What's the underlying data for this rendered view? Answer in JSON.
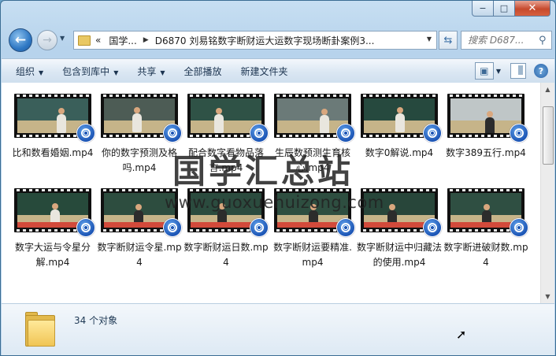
{
  "window": {
    "caption": {
      "minimize": "−",
      "maximize": "□",
      "close": "✕"
    }
  },
  "nav": {
    "address_segments": [
      "«",
      "国学...",
      "D6870 刘易铭数字断财运大运数字现场断卦案例3..."
    ],
    "search_placeholder": "搜索 D687..."
  },
  "toolbar": {
    "items": [
      "组织",
      "包含到库中",
      "共享",
      "全部播放",
      "新建文件夹"
    ]
  },
  "files": [
    {
      "name": "比和数看婚姻.mp4",
      "board": "#3a5f5a",
      "person": "light"
    },
    {
      "name": "你的数字预测及格吗.mp4",
      "board": "#4d5c55",
      "person": "light"
    },
    {
      "name": "配合数字看物品落言.mp4",
      "board": "#2f5246",
      "person": "light"
    },
    {
      "name": "生辰数预测生育核心.mp4",
      "board": "#6b7a78",
      "person": "light"
    },
    {
      "name": "数字0解说.mp4",
      "board": "#26493e",
      "person": "light"
    },
    {
      "name": "数字389五行.mp4",
      "board": "#bfc6c7",
      "person": "dark"
    },
    {
      "name": "数字大运与令星分解.mp4",
      "board": "#274a3b",
      "person": "light"
    },
    {
      "name": "数字断财运令星.mp4",
      "board": "#2d4d3f",
      "person": "dark"
    },
    {
      "name": "数字断财运日数.mp4",
      "board": "#2b4b3e",
      "person": "dark"
    },
    {
      "name": "数字断财运要精准.mp4",
      "board": "#2e4e40",
      "person": "dark"
    },
    {
      "name": "数字断财运中归藏法的使用.mp4",
      "board": "#28463a",
      "person": "dark"
    },
    {
      "name": "数字断进破财数.mp4",
      "board": "#2f4f42",
      "person": "dark"
    }
  ],
  "watermark": {
    "title": "国学汇总站",
    "url": "www.guoxuehuizong.com"
  },
  "details": {
    "count": "34 个对象"
  }
}
